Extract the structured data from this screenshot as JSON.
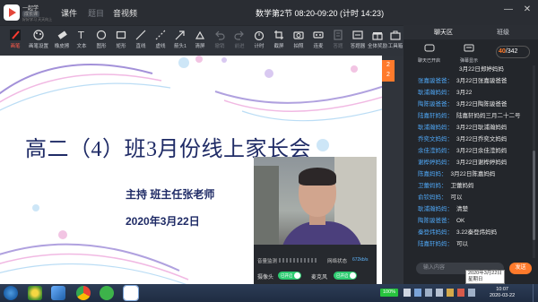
{
  "app": {
    "logo": {
      "name": "一起学",
      "badge": "成长课",
      "tagline": "好好学习 天天向上"
    },
    "nav": [
      {
        "label": "课件",
        "state": "normal"
      },
      {
        "label": "题目",
        "state": "disabled"
      },
      {
        "label": "音视频",
        "state": "normal"
      }
    ],
    "session_title": "数学第2节 08:20-09:20 (计时 14:23)"
  },
  "toolbar": [
    {
      "label": "画笔",
      "icon": "pen-icon",
      "state": "active"
    },
    {
      "label": "画笔设置",
      "icon": "palette-icon",
      "state": "normal"
    },
    {
      "label": "橡皮擦",
      "icon": "eraser-icon",
      "state": "normal"
    },
    {
      "label": "文本",
      "icon": "text-icon",
      "state": "normal"
    },
    {
      "label": "图形",
      "icon": "shape-icon",
      "state": "normal"
    },
    {
      "label": "矩形",
      "icon": "rectangle-icon",
      "state": "normal"
    },
    {
      "label": "直线",
      "icon": "line-icon",
      "state": "normal"
    },
    {
      "label": "虚线",
      "icon": "dashed-line-icon",
      "state": "normal"
    },
    {
      "label": "箭头1",
      "icon": "arrow-icon",
      "state": "normal"
    },
    {
      "label": "清屏",
      "icon": "clear-screen-icon",
      "state": "normal"
    },
    {
      "label": "撤销",
      "icon": "undo-icon",
      "state": "disabled"
    },
    {
      "label": "前进",
      "icon": "redo-icon",
      "state": "disabled"
    },
    {
      "label": "计时",
      "icon": "timer-icon",
      "state": "normal"
    },
    {
      "label": "截屏",
      "icon": "screenshot-icon",
      "state": "normal"
    },
    {
      "label": "拍照",
      "icon": "camera-icon",
      "state": "normal"
    },
    {
      "label": "连麦",
      "icon": "mic-link-icon",
      "state": "normal"
    },
    {
      "label": "答题",
      "icon": "quiz-icon",
      "state": "disabled"
    },
    {
      "label": "答题器",
      "icon": "answer-device-icon",
      "state": "normal"
    },
    {
      "label": "全体奖励",
      "icon": "gift-icon",
      "state": "normal"
    },
    {
      "label": "工具箱",
      "icon": "toolbox-icon",
      "state": "normal"
    }
  ],
  "slide": {
    "title": "高二（4）班3月份线上家长会",
    "host": "主持 班主任张老师",
    "date": "2020年3月22日",
    "page_top": "2",
    "page_bottom": "2"
  },
  "video": {
    "volume_label": "音量监测",
    "network_label": "网络状态",
    "speed": "672kb/s",
    "camera_label": "摄像头",
    "camera_toggle": "已开启",
    "mic_label": "麦克风",
    "mic_toggle": "已开启"
  },
  "panel": {
    "tabs": [
      "聊天区",
      "班级"
    ],
    "tools": [
      "聊天已开启",
      "弹幕显示"
    ],
    "count_current": "40",
    "count_total": "/342",
    "messages": [
      {
        "who": "",
        "text": "3月22日郑婷妈妈"
      },
      {
        "who": "张嘉骏爸爸：",
        "text": "3月22日张嘉骏爸爸"
      },
      {
        "who": "耿浦瀚妈妈：",
        "text": "3月22"
      },
      {
        "who": "陶陈骏爸爸：",
        "text": "3月22日陶陈骏爸爸"
      },
      {
        "who": "陆嘉轩妈妈：",
        "text": "陆嘉轩妈妈三月二十二号"
      },
      {
        "who": "耿浦瀚妈妈：",
        "text": "3月22日耿浦瀚妈妈"
      },
      {
        "who": "乔奕文妈妈：",
        "text": "3月22日乔奕文妈妈"
      },
      {
        "who": "余佳滢妈妈：",
        "text": "3月22日余佳滢妈妈"
      },
      {
        "who": "谢桦婷妈妈：",
        "text": "3月22日谢桦婷妈妈"
      },
      {
        "who": "陈嘉妈妈：",
        "text": "3月22日陈嘉妈妈"
      },
      {
        "who": "卫蕾妈妈：",
        "text": "卫蕾妈妈"
      },
      {
        "who": "俞钦妈妈：",
        "text": "可以"
      },
      {
        "who": "耿浦瀚妈妈：",
        "text": "清楚"
      },
      {
        "who": "陶陈骏爸爸：",
        "text": "OK"
      },
      {
        "who": "秦登炜妈妈：",
        "text": "3.22秦登炜妈妈"
      },
      {
        "who": "陆嘉轩妈妈：",
        "text": "可以"
      }
    ],
    "input_placeholder": "输入内容",
    "send_label": "发送",
    "tooltip_date": "2020年3月22日",
    "tooltip_day": "星期日"
  },
  "taskbar": {
    "battery": "100%",
    "time": "10:07",
    "date": "2020-03-22"
  },
  "colors": {
    "accent": "#ff7a2b",
    "slide_text": "#1f2b66",
    "chat_name": "#4fa6f4",
    "toggle_on": "#2ecc71"
  }
}
